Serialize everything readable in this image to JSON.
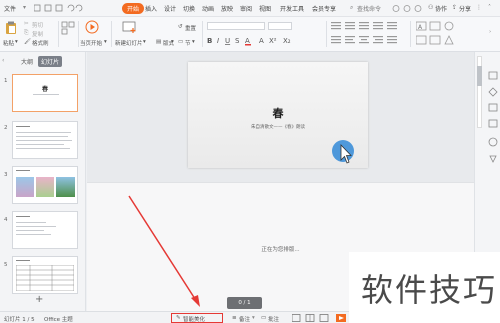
{
  "menubar": {
    "file": "文件",
    "tabs": [
      "开始",
      "插入",
      "设计",
      "切换",
      "动画",
      "放映",
      "审阅",
      "视图",
      "开发工具",
      "会员专享"
    ],
    "search": "查找命令",
    "share": "协作",
    "share2": "分享"
  },
  "ribbon": {
    "paste": "粘贴",
    "cut": "剪切",
    "copy": "复制",
    "format_painter": "格式刷",
    "play_current": "当页开始",
    "new_slide": "新建幻灯片",
    "layout": "版式",
    "reset": "重置",
    "section": "节"
  },
  "left_panel": {
    "tab_outline": "大纲",
    "tab_slides": "幻灯片",
    "slide_numbers": [
      "1",
      "2",
      "3",
      "4",
      "5"
    ],
    "slide1_title": "春",
    "add_label": "+"
  },
  "slide": {
    "title": "春",
    "subtitle": "朱自清散文——《春》朗读"
  },
  "canvas": {
    "loading_text": "正在为您排版...",
    "page_indicator": "0 / 1",
    "notes_placeholder": "智能美化"
  },
  "statusbar": {
    "slide_info": "幻灯片 1 / 5",
    "theme": "Office 主题",
    "smart_beautify": "智能美化",
    "notes": "备注",
    "comments": "批注"
  },
  "watermark": "软件技巧",
  "colors": {
    "accent_orange": "#f36b21",
    "arrow_red": "#e53935",
    "cursor_blue": "#3d8fd8"
  }
}
